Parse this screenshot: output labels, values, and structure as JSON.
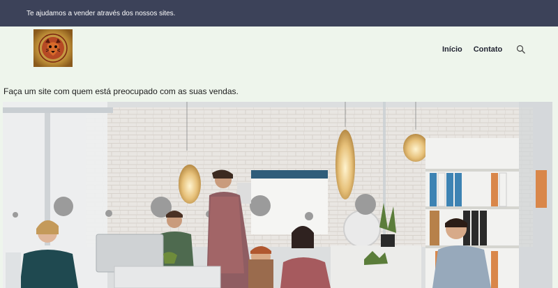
{
  "topbar": {
    "text": "Te ajudamos a vender através dos nossos sites."
  },
  "nav": {
    "items": [
      {
        "label": "Início"
      },
      {
        "label": "Contato"
      }
    ],
    "search_icon": "search-icon"
  },
  "hero": {
    "tagline": "Faça um site com quem está preocupado com as suas vendas."
  },
  "colors": {
    "topbar": "#3c4259",
    "page_background": "#eef5ec",
    "logo_background": "#c8a24a"
  }
}
